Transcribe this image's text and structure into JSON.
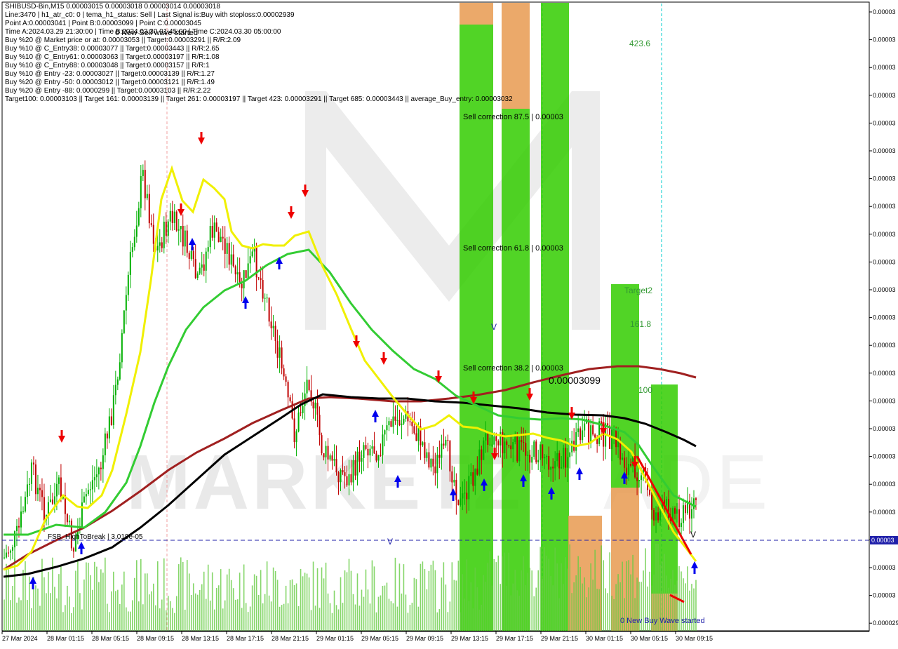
{
  "header": {
    "lines": [
      "SHIBUSD-Bin,M15  0.00003015 0.00003018 0.00003014 0.00003018",
      "Line:3470 | h1_atr_c0: 0 | tema_h1_status: Sell | Last Signal is:Buy with stoploss:0.00002939",
      "Point A:0.00003041 | Point B:0.00003099 | Point C:0.00003045",
      "Time A:2024.03.29 21:30:00 | Time B:2024.03.30 01:45:00 | Time C:2024.03.30 05:00:00",
      "Buy %20 @ Market price or at: 0.00003053 || Target:0.00003291 || R/R:2.09",
      "Buy %10 @ C_Entry38: 0.00003077 || Target:0.00003443 || R/R:2.65",
      "Buy %10 @ C_Entry61: 0.00003063 || Target:0.00003197 || R/R:1.08",
      "Buy %10 @ C_Entry88: 0.00003048 || Target:0.00003157 || R/R:1",
      "Buy %10 @ Entry -23: 0.00003027 || Target:0.00003139 || R/R:1.27",
      "Buy %20 @ Entry -50: 0.00003012 || Target:0.00003121 || R/R:1.49",
      "Buy %20 @ Entry -88: 0.0000299 || Target:0.00003103 || R/R:2.22",
      "Target100: 0.00003103 || Target 161: 0.00003139 || Target 261: 0.00003197 || Target 423: 0.00003291 || Target 685: 0.00003443 || average_Buy_entry: 0.00003032"
    ]
  },
  "chart_annotations": {
    "new_sell_wave": "0 New Sell wave started",
    "new_buy_wave": "0 New Buy Wave started",
    "sell_correction_875": "Sell correction 87.5 | 0.00003",
    "sell_correction_618": "Sell correction 61.8 | 0.00003",
    "sell_correction_382": "Sell correction 38.2 | 0.00003",
    "level_4236": "423.6",
    "target2": "Target2",
    "level_1618": "161.8",
    "level_100": "100",
    "point_b_price": "0.00003099",
    "fsb_label": "FSB_HighToBreak | 3.019e-05",
    "current_price_tag": "0.00003",
    "marker_v_left": "V",
    "marker_v_right": "V",
    "marker_v_top": "V"
  },
  "colors": {
    "bull_candle": "#00b000",
    "bear_candle": "#c00000",
    "ema_yellow": "#f0f000",
    "ema_green": "#33cc33",
    "ma_darkred": "#a02020",
    "ma_black": "#000000",
    "zone_green": "#33cc00",
    "zone_orange": "#e89a50",
    "volume": "#66cc44",
    "price_line": "#0000aa",
    "cyan_line": "#00cccc"
  },
  "chart_data": {
    "type": "candlestick",
    "symbol": "SHIBUSD-Bin",
    "timeframe": "M15",
    "x_tick_labels": [
      "27 Mar 2024",
      "28 Mar 01:15",
      "28 Mar 05:15",
      "28 Mar 09:15",
      "28 Mar 13:15",
      "28 Mar 17:15",
      "28 Mar 21:15",
      "29 Mar 01:15",
      "29 Mar 05:15",
      "29 Mar 09:15",
      "29 Mar 13:15",
      "29 Mar 17:15",
      "29 Mar 21:15",
      "30 Mar 01:15",
      "30 Mar 05:15",
      "30 Mar 09:15"
    ],
    "y_tick_labels": [
      "0.00003",
      "0.00003",
      "0.00003",
      "0.00003",
      "0.00003",
      "0.00003",
      "0.00003",
      "0.00003",
      "0.00003",
      "0.00003",
      "0.00003",
      "0.00003",
      "0.00003",
      "0.00003",
      "0.00003",
      "0.00003",
      "0.00003",
      "0.00003",
      "0.00003",
      "0.00003",
      "0.00003",
      "0.00003",
      "0.000029"
    ],
    "ylim": [
      2.9e-05,
      3.48e-05
    ],
    "last_close": 3.018e-05,
    "close_series": [
      2.962e-05,
      2.985e-05,
      3.045e-05,
      3.003e-05,
      3.028e-05,
      2.97e-05,
      3.025e-05,
      3.05e-05,
      3.115e-05,
      3.232e-05,
      3.327e-05,
      3.252e-05,
      3.285e-05,
      3.264e-05,
      3.221e-05,
      3.273e-05,
      3.261e-05,
      3.215e-05,
      3.249e-05,
      3.206e-05,
      3.145e-05,
      3.078e-05,
      3.135e-05,
      3.063e-05,
      3.047e-05,
      3.035e-05,
      3.071e-05,
      3.065e-05,
      3.09e-05,
      3.095e-05,
      3.077e-05,
      3.048e-05,
      3.065e-05,
      3.011e-05,
      3.043e-05,
      3.082e-05,
      3.071e-05,
      3.065e-05,
      3.063e-05,
      3.06e-05,
      3.051e-05,
      3.065e-05,
      3.082e-05,
      3.081e-05,
      3.075e-05,
      3.048e-05,
      3.046e-05,
      3.003e-05,
      3.01e-05,
      3.001e-05,
      3.018e-05
    ]
  }
}
